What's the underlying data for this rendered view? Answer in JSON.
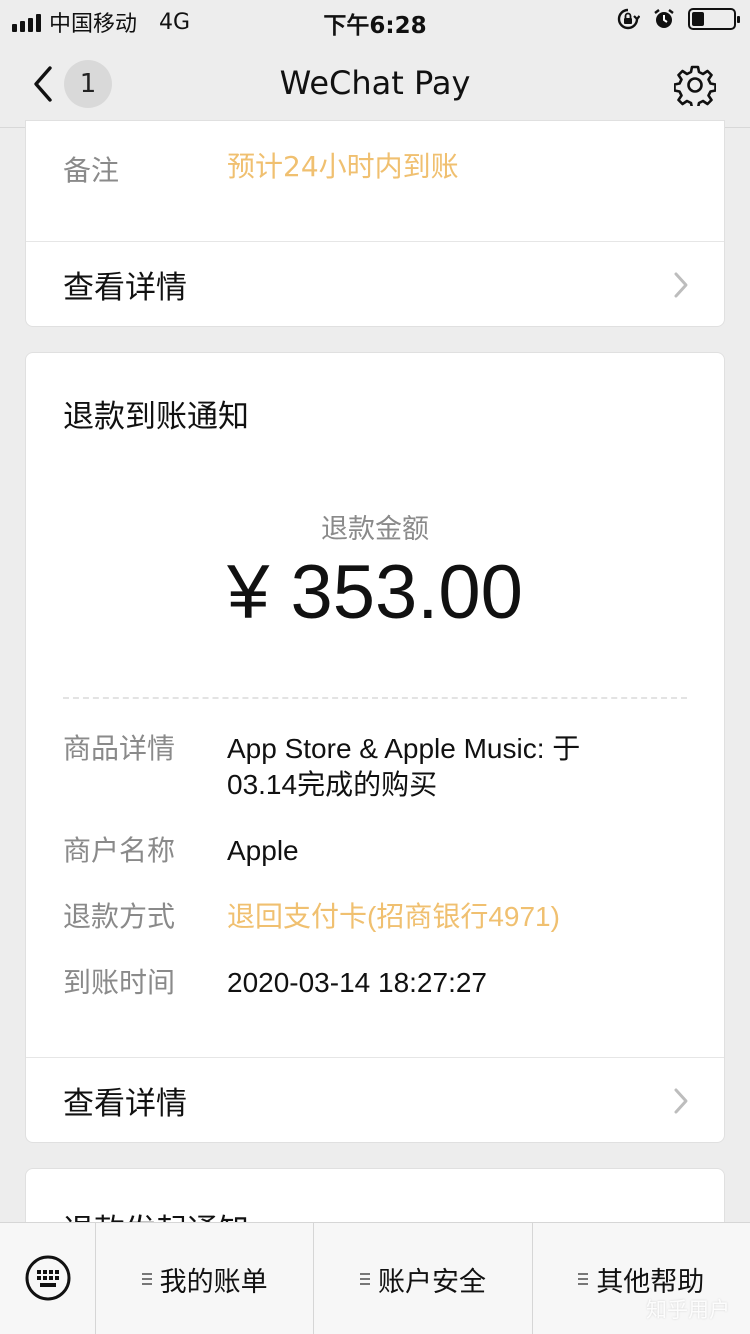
{
  "status_bar": {
    "carrier": "中国移动",
    "network": "4G",
    "time": "下午6:28"
  },
  "nav": {
    "badge_count": "1",
    "title": "WeChat Pay",
    "icons": [
      "chevron-left-icon",
      "gear-icon"
    ]
  },
  "card1": {
    "note_label": "备注",
    "note_value": "预计24小时内到账",
    "details_label": "查看详情"
  },
  "card2": {
    "title": "退款到账通知",
    "amount_label": "退款金额",
    "amount_value": "¥ 353.00",
    "items": [
      {
        "label": "商品详情",
        "value": "App Store & Apple Music: 于 03.14完成的购买"
      },
      {
        "label": "商户名称",
        "value": "Apple"
      },
      {
        "label": "退款方式",
        "value": "退回支付卡(招商银行4971)"
      },
      {
        "label": "到账时间",
        "value": "2020-03-14 18:27:27"
      }
    ],
    "details_label": "查看详情"
  },
  "card3": {
    "title": "退款发起通知"
  },
  "tab_bar": {
    "tabs": [
      "我的账单",
      "账户安全",
      "其他帮助"
    ]
  },
  "watermark": "知乎用户",
  "colors": {
    "accent_orange": "#f0c070",
    "background": "#ededed",
    "label_gray": "#8a8a8a"
  }
}
